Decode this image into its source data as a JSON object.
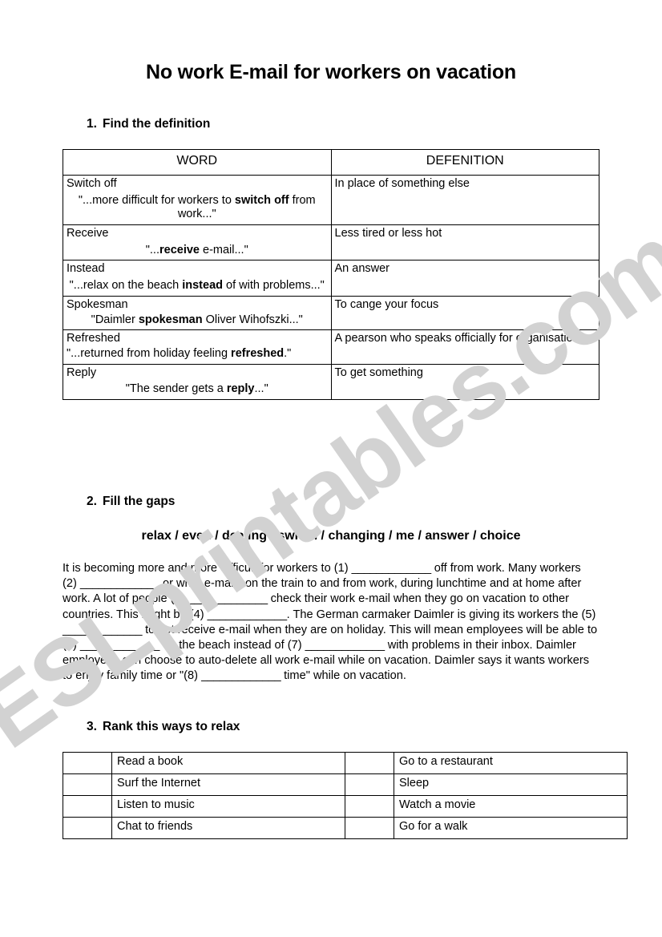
{
  "document": {
    "title": "No work E-mail for workers on vacation",
    "watermark": "ESLprintables.com",
    "watermark_color": "#d2d2d2",
    "page_background": "#ffffff",
    "text_color": "#000000"
  },
  "sections": {
    "one": {
      "number": "1.",
      "title": "Find the definition"
    },
    "two": {
      "number": "2.",
      "title": "Fill the gaps"
    },
    "three": {
      "number": "3.",
      "title": "Rank this ways to relax"
    }
  },
  "definition_table": {
    "headers": {
      "word": "WORD",
      "definition": "DEFENITION"
    },
    "rows": [
      {
        "word": "Switch off",
        "quote_before": "\"...more difficult for workers to ",
        "quote_bold": "switch off",
        "quote_after": " from work...\"",
        "definition": "In place of something else"
      },
      {
        "word": "Receive",
        "quote_before": "\"...",
        "quote_bold": "receive",
        "quote_after": " e-mail...\"",
        "definition": "Less tired or less hot"
      },
      {
        "word": "Instead",
        "quote_before": "\"...relax on the beach ",
        "quote_bold": "instead",
        "quote_after": " of with problems...\"",
        "definition": "An answer"
      },
      {
        "word": "Spokesman",
        "quote_before": "\"Daimler ",
        "quote_bold": "spokesman",
        "quote_after": " Oliver Wihofszki...\"",
        "definition": "To cange your focus"
      },
      {
        "word": "Refreshed",
        "quote_before": "\"...returned from holiday feeling ",
        "quote_bold": "refreshed",
        "quote_after": ".\"",
        "definition": "A pearson who speaks officially for organisation"
      },
      {
        "word": "Reply",
        "quote_before": "\"The sender gets a ",
        "quote_bold": "reply",
        "quote_after": "...\"",
        "definition": "To get something"
      }
    ]
  },
  "word_bank": {
    "line": "relax / even / dealing / switch / changing / me / answer / choice",
    "words": [
      "relax",
      "even",
      "dealing",
      "switch",
      "changing",
      "me",
      "answer",
      "choice"
    ]
  },
  "gap_fill": {
    "blank": "_____________",
    "full_text": "It is becoming more and more difficult for workers to (1) _____________ off from work. Many workers (2) _____________ or write e-mails on the train to and from work, during lunchtime and at home after work. A lot of people (3) _____________ check their work e-mail when they go on vacation to other countries. This might be (4) _____________. The German carmaker Daimler is giving its workers the (5) _____________ to not receive e-mail when they are on holiday. This will mean employees will be able to (6) _____________ on the beach instead of (7) _____________ with problems in their inbox. Daimler employees can choose to auto-delete all work e-mail while on vacation. Daimler says it wants workers to enjoy family time or \"(8) _____________ time\" while on vacation.",
    "segments": [
      {
        "text": "It is becoming more and more difficult for workers to (1) "
      },
      {
        "blank": true
      },
      {
        "text": " off from work. Many workers (2) "
      },
      {
        "blank": true
      },
      {
        "text": " or write e-mails on the train to and from work, during lunchtime and at home after work. A lot of people (3) "
      },
      {
        "blank": true
      },
      {
        "text": " check their work e-mail when they go on vacation to other countries. This might be (4) "
      },
      {
        "blank": true
      },
      {
        "text": ". The German carmaker Daimler is giving its workers the (5) "
      },
      {
        "blank": true
      },
      {
        "text": " to not receive e-mail when they are on holiday. This will mean employees will be able to (6) "
      },
      {
        "blank": true
      },
      {
        "text": " on the beach instead of (7) "
      },
      {
        "blank": true
      },
      {
        "text": " with problems in their inbox. Daimler employees can choose to auto-delete all work e-mail while on vacation. Daimler says it wants workers to enjoy family time or \"(8) "
      },
      {
        "blank": true
      },
      {
        "text": " time\" while on vacation."
      }
    ]
  },
  "rank_table": {
    "rows": [
      {
        "left_box": "",
        "left_item": "Read a book",
        "right_box": "",
        "right_item": "Go to a restaurant"
      },
      {
        "left_box": "",
        "left_item": "Surf the Internet",
        "right_box": "",
        "right_item": "Sleep"
      },
      {
        "left_box": "",
        "left_item": "Listen to music",
        "right_box": "",
        "right_item": "Watch a movie"
      },
      {
        "left_box": "",
        "left_item": "Chat to friends",
        "right_box": "",
        "right_item": "Go for a walk"
      }
    ]
  }
}
